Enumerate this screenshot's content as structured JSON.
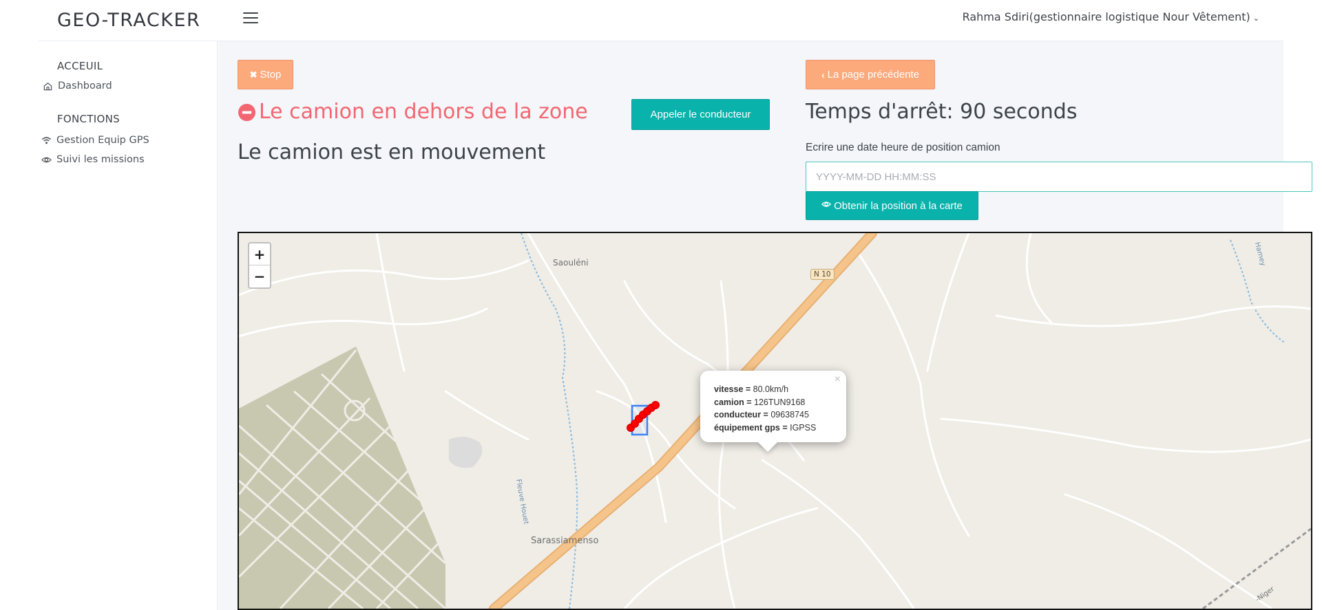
{
  "app": {
    "brand": "GEO-TRACKER",
    "user": "Rahma Sdiri(gestionnaire logistique Nour Vêtement)"
  },
  "sidebar": {
    "sections": [
      {
        "heading": "ACCEUIL",
        "items": [
          {
            "label": "Dashboard",
            "icon": "home-icon"
          }
        ]
      },
      {
        "heading": "FONCTIONS",
        "items": [
          {
            "label": "Gestion Equip GPS",
            "icon": "wifi-icon"
          },
          {
            "label": "Suivi les missions",
            "icon": "eye-icon"
          }
        ]
      }
    ]
  },
  "main": {
    "stop_button": "Stop",
    "alert_title": "Le camion en dehors de la zone",
    "call_button": "Appeler le conducteur",
    "status_text": "Le camion est en mouvement",
    "back_button": "La page précédente",
    "stop_time": "Temps d'arrêt: 90 seconds",
    "date_label": "Ecrire une date heure de position camion",
    "date_placeholder": "YYYY-MM-DD HH:MM:SS",
    "date_value": "",
    "position_button": "Obtenir la position à la carte"
  },
  "map": {
    "zoom_in": "+",
    "zoom_out": "−",
    "places": {
      "saouleni": "Saouléni",
      "road": "N 10",
      "sarassiamenso": "Sarassiamenso",
      "fleuve": "Fleuve Houet",
      "niger": "-Niger",
      "hamey": "Hamey"
    },
    "popup": {
      "close": "×",
      "speed_label": "vitesse =",
      "speed_value": "80.0km/h",
      "truck_label": "camion =",
      "truck_value": "126TUN9168",
      "driver_label": "conducteur =",
      "driver_value": "09638745",
      "gps_label": "équipement gps =",
      "gps_value": "IGPSS"
    },
    "colors": {
      "route": "#f5c48a",
      "track": "#ff0000",
      "zone": "#3b82f6",
      "block": "#c8c8b0"
    }
  },
  "colors": {
    "accent_teal": "#0ab2ac",
    "accent_orange": "#fca97c",
    "alert_red": "#f26672"
  }
}
